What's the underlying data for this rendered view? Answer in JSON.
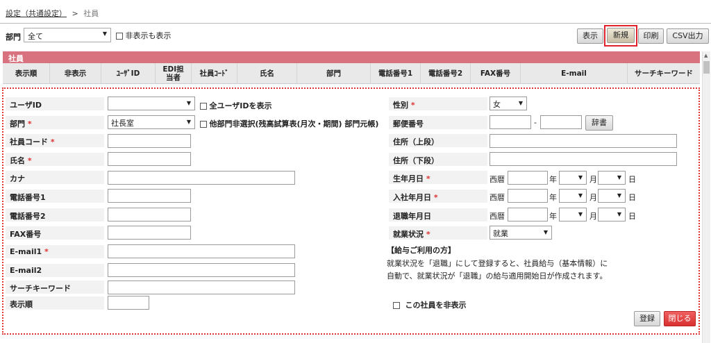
{
  "breadcrumb": {
    "link": "設定（共通設定）",
    "separator": ">",
    "current": "社員"
  },
  "filter": {
    "dept_label": "部門",
    "dept_value": "全て",
    "show_hidden_label": "非表示も表示"
  },
  "toolbar": {
    "show": "表示",
    "new": "新規",
    "print": "印刷",
    "csv": "CSV出力"
  },
  "section_title": "社員",
  "columns": [
    "表示順",
    "非表示",
    "ﾕｰｻﾞID",
    "EDI担当者",
    "社員ｺｰﾄﾞ",
    "氏名",
    "部門",
    "電話番号1",
    "電話番号2",
    "FAX番号",
    "E-mail",
    "サーチキーワード"
  ],
  "left_fields": {
    "userid": "ユーザID",
    "dept": "部門",
    "code": "社員コード",
    "name": "氏名",
    "kana": "カナ",
    "tel1": "電話番号1",
    "tel2": "電話番号2",
    "fax": "FAX番号",
    "email1": "E-mail1",
    "email2": "E-mail2",
    "search": "サーチキーワード",
    "order": "表示順"
  },
  "required_mark": "*",
  "dept_select_value": "社長室",
  "show_all_userid": "全ユーザIDを表示",
  "other_dept_option": "他部門非選択(残高試算表(月次・期間) 部門元帳)",
  "right_fields": {
    "gender": "性別",
    "gender_value": "女",
    "postal": "郵便番号",
    "postal_sep": "-",
    "dict_btn": "辞書",
    "addr1": "住所（上段）",
    "addr2": "住所（下段）",
    "birth": "生年月日",
    "hire": "入社年月日",
    "retire": "退職年月日",
    "status": "就業状況",
    "status_value": "就業",
    "era": "西暦",
    "year": "年",
    "month": "月",
    "day": "日"
  },
  "note": {
    "title": "【給与ご利用の方】",
    "line1": "就業状況を「退職」にして登録すると、社員給与（基本情報）に",
    "line2": "自動で、就業状況が「退職」の給与適用開始日が作成されます。"
  },
  "hide_employee": "この社員を非表示",
  "actions": {
    "register": "登録",
    "close": "閉じる"
  }
}
